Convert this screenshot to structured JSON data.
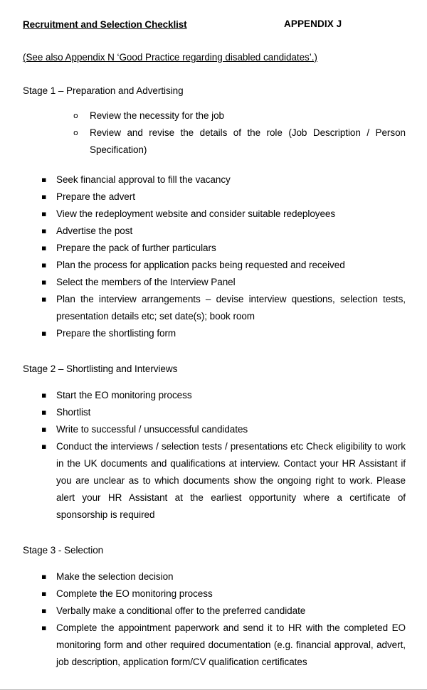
{
  "document": {
    "title": "Recruitment and Selection Checklist",
    "appendix_label": "APPENDIX J",
    "see_also": "(See also Appendix N ‘Good Practice regarding disabled candidates’.)",
    "text_color": "#000000",
    "page_background": "#ffffff"
  },
  "bullets": {
    "circle": "o",
    "square": "▪"
  },
  "stages": [
    {
      "heading": "Stage 1 – Preparation and Advertising",
      "circle_items": [
        "Review the necessity for the job",
        "Review and revise the details of the role (Job Description / Person Specification)"
      ],
      "square_items": [
        "Seek financial approval to fill the vacancy",
        "Prepare the advert",
        "View the redeployment website and consider suitable redeployees",
        "Advertise the post",
        "Prepare the pack of further particulars",
        "Plan the process for application packs being requested and received",
        "Select the members of the Interview Panel",
        "Plan the interview arrangements – devise interview questions, selection tests, presentation details etc; set date(s); book room",
        "Prepare the shortlisting form"
      ]
    },
    {
      "heading": "Stage 2 – Shortlisting and Interviews",
      "circle_items": [],
      "square_items": [
        "Start the EO monitoring process",
        "Shortlist",
        "Write to successful / unsuccessful candidates",
        "Conduct the interviews / selection tests / presentations etc Check eligibility to work in the UK documents and qualifications at interview. Contact your HR Assistant if you are unclear as to which documents show the ongoing right to work. Please alert your HR Assistant at the earliest opportunity where a certificate of sponsorship is required"
      ]
    },
    {
      "heading": "Stage 3 - Selection",
      "circle_items": [],
      "square_items": [
        "Make the selection decision",
        "Complete the EO monitoring process",
        "Verbally make a conditional offer to the preferred candidate",
        "Complete the appointment paperwork and send it to HR with the completed EO monitoring form and other required documentation (e.g. financial approval, advert, job description, application form/CV qualification certificates"
      ]
    }
  ]
}
